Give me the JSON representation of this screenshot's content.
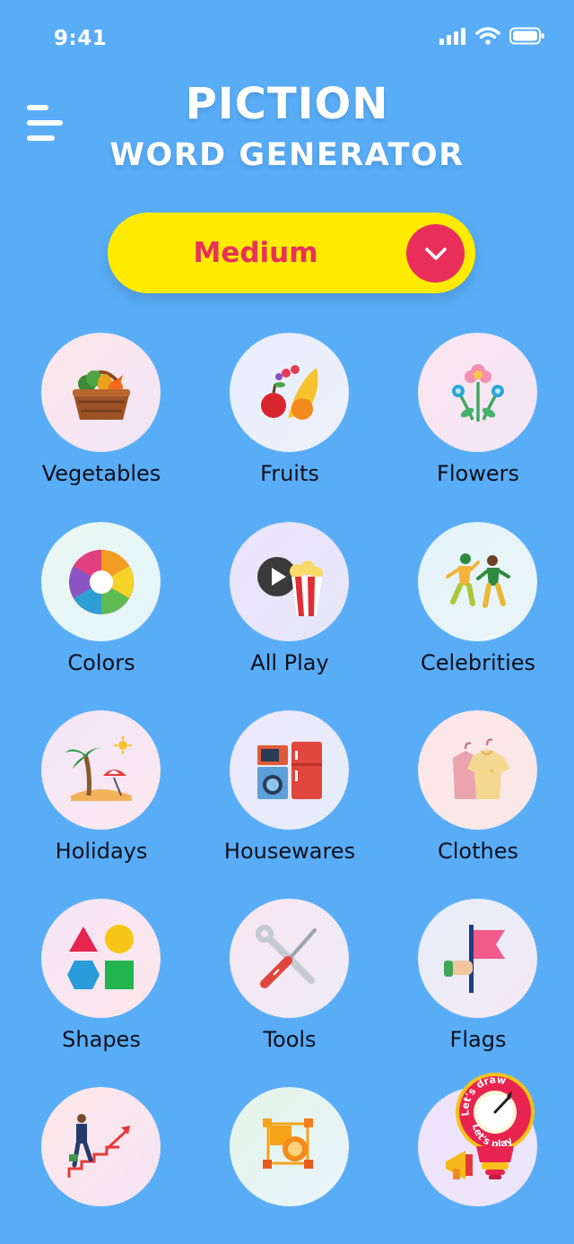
{
  "status": {
    "time": "9:41"
  },
  "header": {
    "title": "PICTION",
    "subtitle": "WORD GENERATOR"
  },
  "difficulty": {
    "selected": "Medium"
  },
  "categories": [
    {
      "label": "Vegetables",
      "icon": "vegetable-basket-icon"
    },
    {
      "label": "Fruits",
      "icon": "fruits-icon"
    },
    {
      "label": "Flowers",
      "icon": "flowers-icon"
    },
    {
      "label": "Colors",
      "icon": "color-wheel-icon"
    },
    {
      "label": "All Play",
      "icon": "popcorn-play-icon"
    },
    {
      "label": "Celebrities",
      "icon": "dancers-icon"
    },
    {
      "label": "Holidays",
      "icon": "palm-beach-icon"
    },
    {
      "label": "Housewares",
      "icon": "appliances-icon"
    },
    {
      "label": "Clothes",
      "icon": "clothes-hanger-icon"
    },
    {
      "label": "Shapes",
      "icon": "shapes-icon"
    },
    {
      "label": "Tools",
      "icon": "tools-icon"
    },
    {
      "label": "Flags",
      "icon": "flag-icon"
    },
    {
      "label": "",
      "icon": "career-stairs-icon"
    },
    {
      "label": "",
      "icon": "design-shapes-icon"
    },
    {
      "label": "",
      "icon": "megaphone-icon"
    }
  ],
  "badge": {
    "text_top": "Let's draw",
    "text_bottom": "Let's play"
  },
  "colors": {
    "background": "#59adf7",
    "accent_yellow": "#ffeb00",
    "accent_pink": "#ea2e5b"
  }
}
